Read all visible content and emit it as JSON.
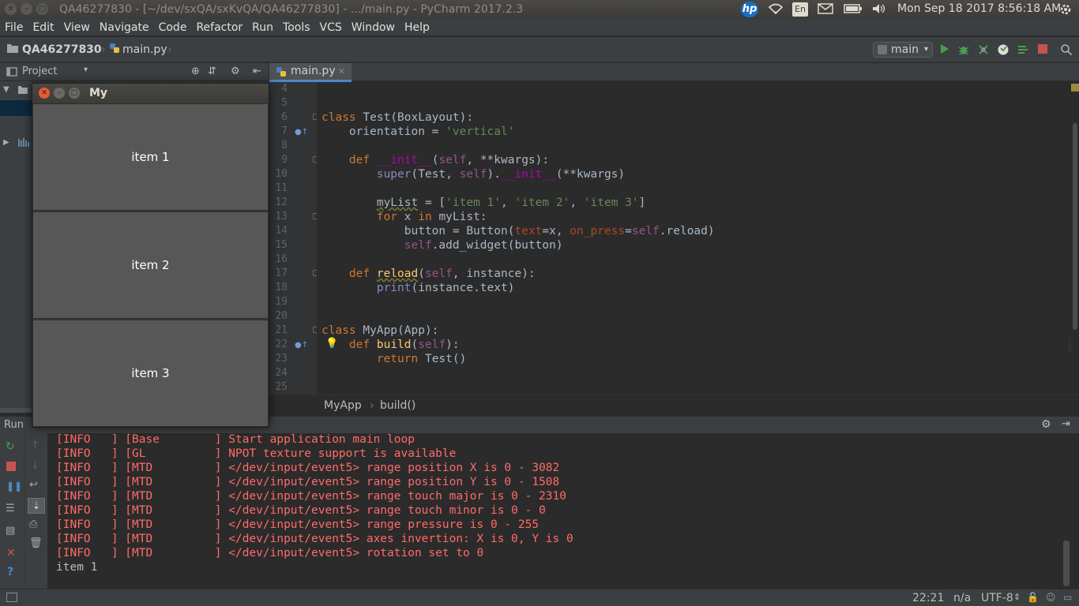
{
  "system": {
    "window_title": "QA46277830 - [~/dev/sxQA/sxKvQA/QA46277830] - .../main.py - PyCharm 2017.2.3",
    "keyboard_layout": "En",
    "clock": "Mon Sep 18 2017  8:56:18 AM",
    "brand_logo": "hp"
  },
  "menu": [
    "File",
    "Edit",
    "View",
    "Navigate",
    "Code",
    "Refactor",
    "Run",
    "Tools",
    "VCS",
    "Window",
    "Help"
  ],
  "nav": {
    "project": "QA46277830",
    "file": "main.py",
    "run_config": "main"
  },
  "project_panel": {
    "title": "Project"
  },
  "editor": {
    "tab": "main.py",
    "breadcrumb": [
      "MyApp",
      "build()"
    ],
    "line_numbers": [
      "4",
      "5",
      "6",
      "7",
      "8",
      "9",
      "10",
      "11",
      "12",
      "13",
      "14",
      "15",
      "16",
      "17",
      "18",
      "19",
      "20",
      "21",
      "22",
      "23",
      "24",
      "25"
    ]
  },
  "kivy_window": {
    "title": "My",
    "items": [
      "item 1",
      "item 2",
      "item 3"
    ]
  },
  "run_panel": {
    "title": "Run",
    "log": [
      "[INFO   ] [Base        ] Start application main loop",
      "[INFO   ] [GL          ] NPOT texture support is available",
      "[INFO   ] [MTD         ] </dev/input/event5> range position X is 0 - 3082",
      "[INFO   ] [MTD         ] </dev/input/event5> range position Y is 0 - 1508",
      "[INFO   ] [MTD         ] </dev/input/event5> range touch major is 0 - 2310",
      "[INFO   ] [MTD         ] </dev/input/event5> range touch minor is 0 - 0",
      "[INFO   ] [MTD         ] </dev/input/event5> range pressure is 0 - 255",
      "[INFO   ] [MTD         ] </dev/input/event5> axes invertion: X is 0, Y is 0",
      "[INFO   ] [MTD         ] </dev/input/event5> rotation set to 0"
    ],
    "output": "item 1"
  },
  "status": {
    "position": "22:21",
    "line_sep": "n/a",
    "encoding": "UTF-8"
  },
  "colors": {
    "accent": "#4a88c7",
    "run_green": "#499c54",
    "stop_red": "#c75450",
    "log_red": "#ff6b68"
  }
}
